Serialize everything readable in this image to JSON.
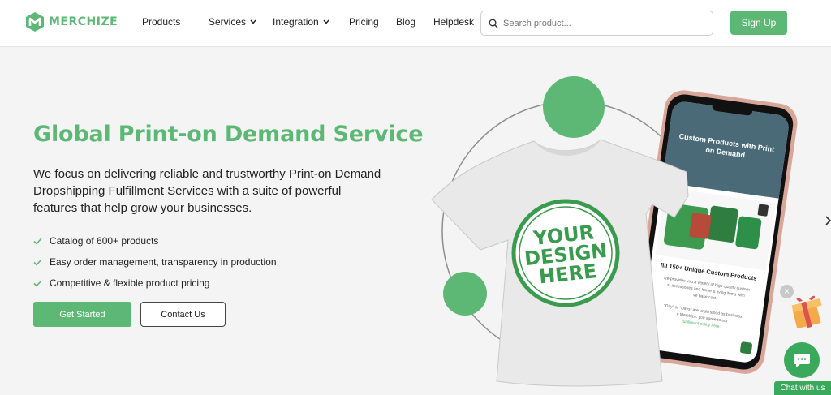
{
  "brand": {
    "name": "MERCHIZE"
  },
  "nav": {
    "items": [
      {
        "label": "Products",
        "dropdown": false
      },
      {
        "label": "Services",
        "dropdown": true
      },
      {
        "label": "Integration",
        "dropdown": true
      },
      {
        "label": "Pricing",
        "dropdown": false
      },
      {
        "label": "Blog",
        "dropdown": false
      },
      {
        "label": "Helpdesk",
        "dropdown": false
      }
    ],
    "search_placeholder": "Search product...",
    "signup_label": "Sign Up"
  },
  "hero": {
    "title": "Global Print-on Demand Service",
    "description": "We focus on delivering reliable and trustworthy Print-on Demand Dropshipping Fulfillment Services with a suite of powerful features that help grow your businesses.",
    "features": [
      "Catalog of 600+ products",
      "Easy order management, transparency in production",
      "Competitive & flexible product pricing"
    ],
    "primary_cta": "Get Started",
    "secondary_cta": "Contact Us"
  },
  "illustration": {
    "shirt_text": [
      "YOUR",
      "DESIGN",
      "HERE"
    ],
    "phone_heading": [
      "Custom Products with Print",
      "on Demand"
    ],
    "phone_section": "fill 150+ Unique Custom Products",
    "phone_body": [
      "ize provides you a variety of high-quality custom",
      "s, accessories and home & living items with",
      "ve base cost."
    ],
    "phone_footer": [
      "\"Day\" or \"Days\" are understood as business",
      "g Merchize, you agree to our",
      "fulfillment policy here."
    ]
  },
  "widgets": {
    "chat_label": "Chat with us",
    "close_symbol": "×"
  },
  "colors": {
    "accent": "#5db875",
    "chat": "#3aa95c"
  }
}
